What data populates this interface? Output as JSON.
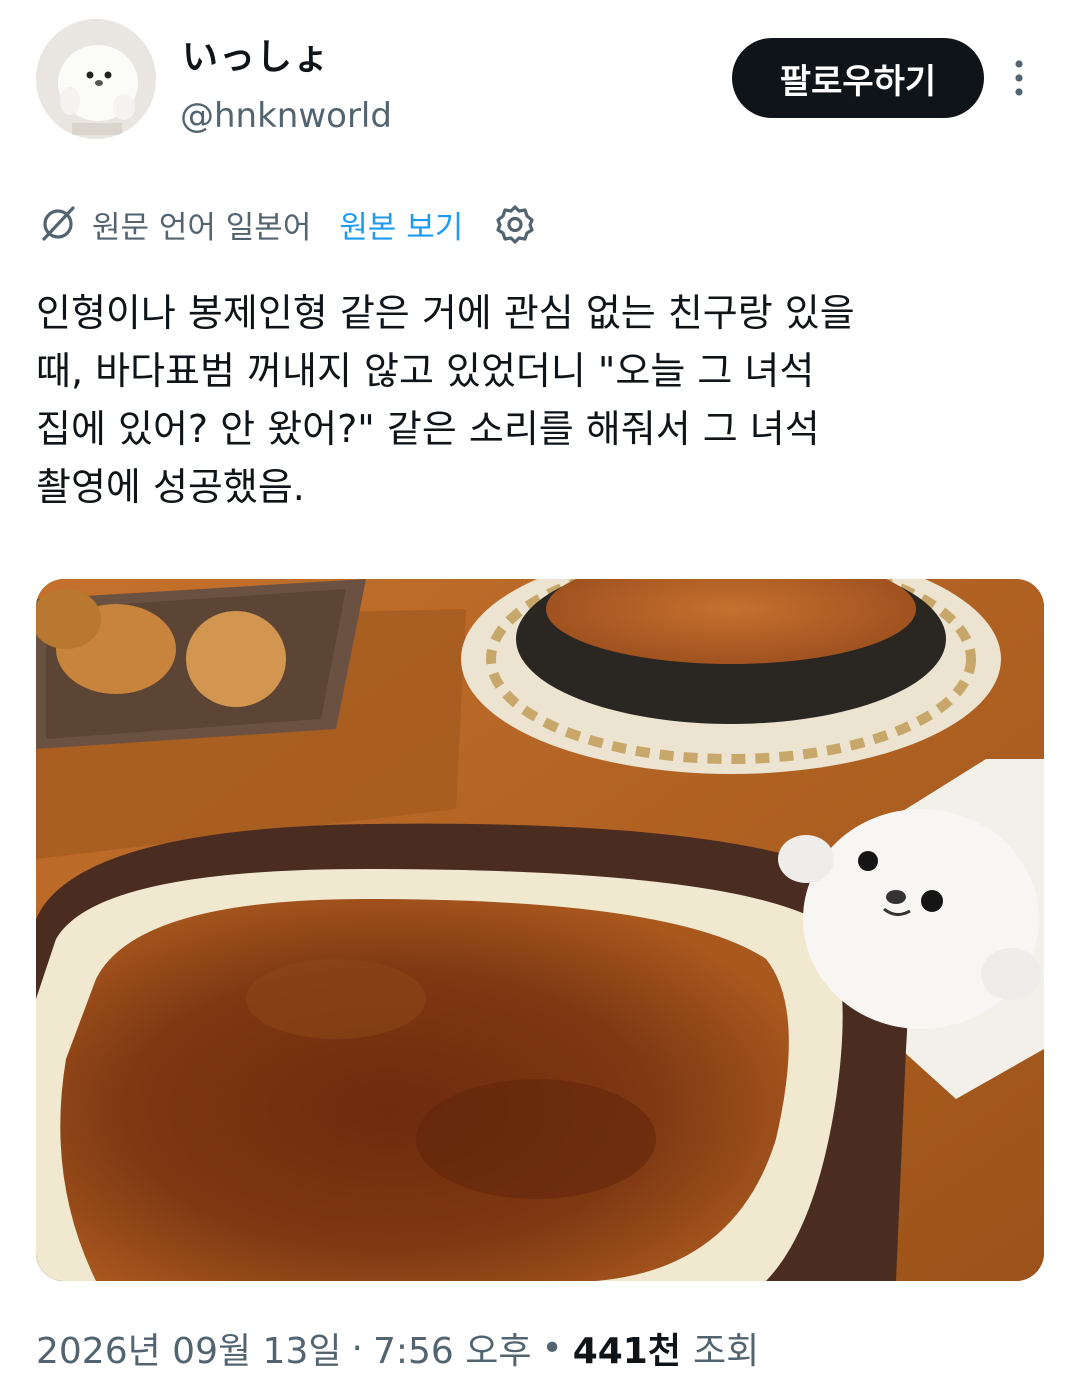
{
  "author": {
    "display_name": "いっしょ",
    "handle": "@hnknworld"
  },
  "actions": {
    "follow_label": "팔로우하기",
    "more_icon": "more-vertical-icon"
  },
  "translation": {
    "icon": "translate-icon",
    "note": "원문 언어 일본어",
    "view_original_label": "원본 보기",
    "settings_icon": "gear-icon",
    "link_color": "#1d9bf0"
  },
  "tweet": {
    "text": "인형이나 봉제인형 같은 거에 관심 없는 친구랑 있을\n때, 바다표범 꺼내지 않고 있었더니 \"오늘 그 녀석\n집에 있어? 안 왔어?\" 같은 소리를 해줘서 그 녀석\n촬영에 성공했음.",
    "photo_icon": "photo-gratin-and-seal-plush"
  },
  "meta": {
    "date": "2026년 09월 13일",
    "dot": "·",
    "time": "7:56 오후",
    "bullet": "•",
    "views_count": "441천",
    "views_label": "조회"
  },
  "colors": {
    "primary_text": "#0f1419",
    "secondary_text": "#536471",
    "button_bg": "#0f1419"
  }
}
